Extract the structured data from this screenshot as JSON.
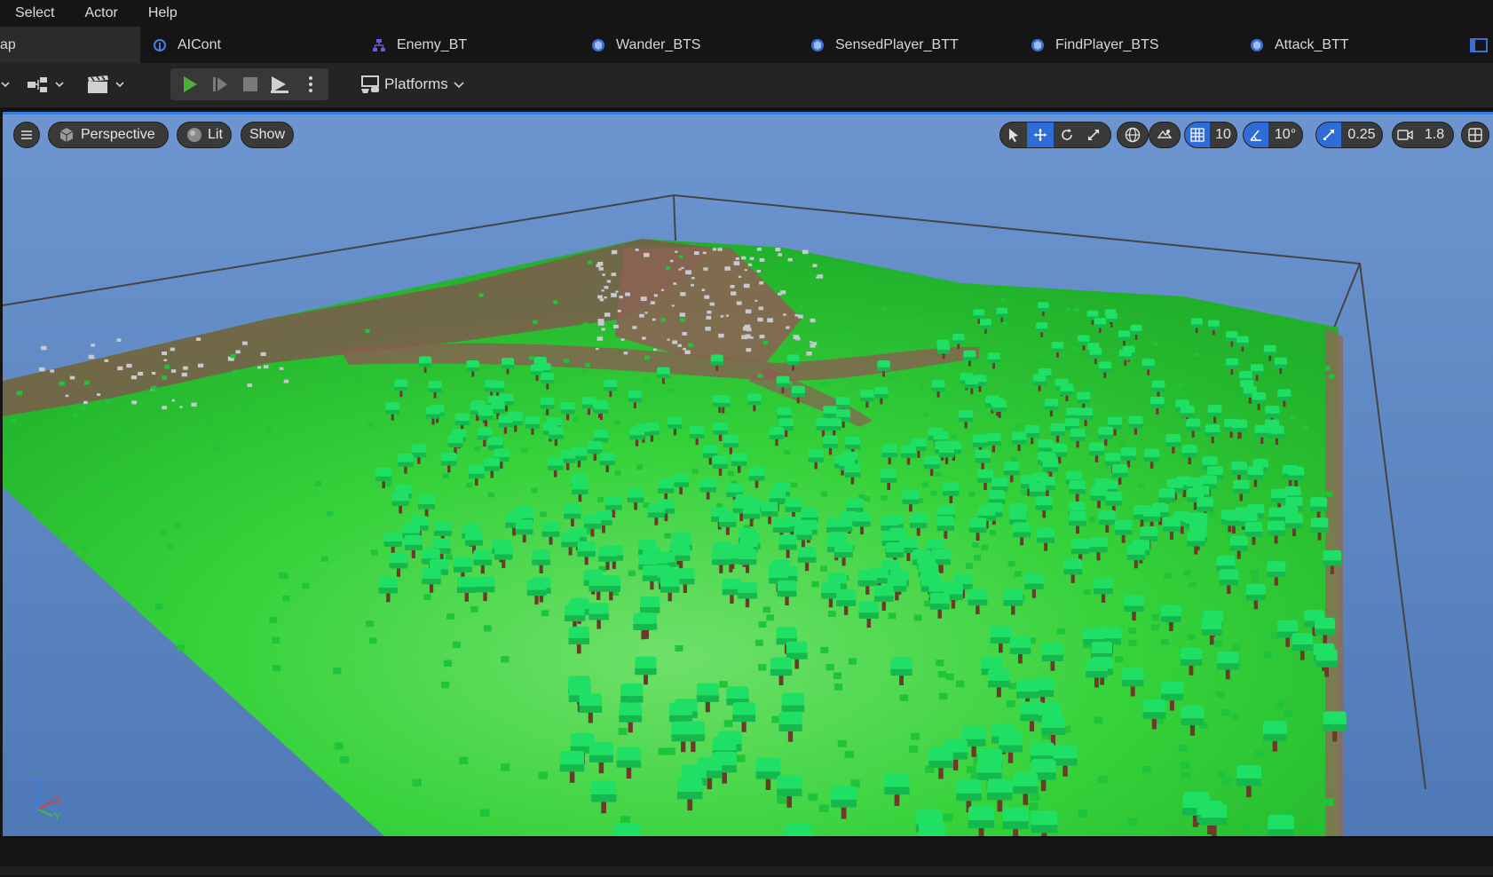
{
  "menu": {
    "items": [
      "Select",
      "Actor",
      "Help"
    ]
  },
  "tabs": [
    {
      "label": "ap",
      "icon": "map-icon"
    },
    {
      "label": "AICont",
      "icon": "ai-controller-icon"
    },
    {
      "label": "Enemy_BT",
      "icon": "behavior-tree-icon"
    },
    {
      "label": "Wander_BTS",
      "icon": "blueprint-icon"
    },
    {
      "label": "SensedPlayer_BTT",
      "icon": "blueprint-icon"
    },
    {
      "label": "FindPlayer_BTS",
      "icon": "blueprint-icon"
    },
    {
      "label": "Attack_BTT",
      "icon": "blueprint-icon"
    }
  ],
  "toolbar": {
    "platforms_label": "Platforms"
  },
  "viewport": {
    "perspective_label": "Perspective",
    "lit_label": "Lit",
    "show_label": "Show",
    "grid_snap": "10",
    "rotation_snap": "10°",
    "scale_snap": "0.25",
    "camera_speed": "1.8",
    "axis": {
      "z": "Z",
      "x": "X",
      "y": "Y"
    }
  },
  "colors": {
    "accent": "#2f6cd6",
    "play_green": "#4caf3a",
    "grass": "#2fd03a",
    "sky": "#5b87c2"
  }
}
